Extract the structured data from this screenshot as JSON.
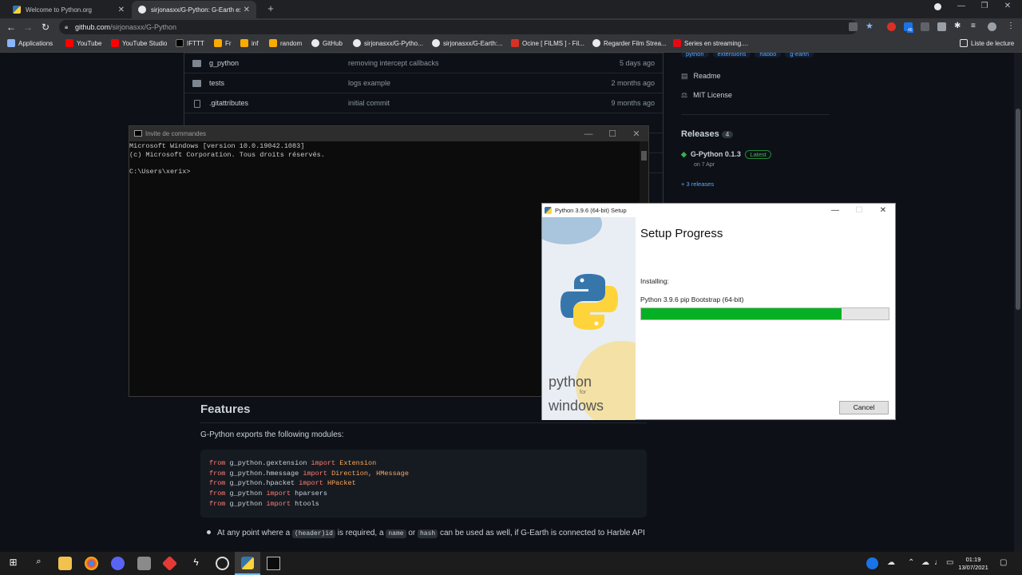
{
  "browser": {
    "tabs": [
      {
        "title": "Welcome to Python.org",
        "active": false
      },
      {
        "title": "sirjonasxx/G-Python: G-Earth ext",
        "active": true
      }
    ],
    "url_host": "github.com",
    "url_path": "/sirjonasxx/G-Python",
    "bookmarks": [
      "Applications",
      "YouTube",
      "YouTube Studio",
      "IFTTT",
      "Fr",
      "inf",
      "random",
      "GitHub",
      "sirjonasxx/G-Pytho...",
      "sirjonasxx/G-Earth:...",
      "Ocine [ FILMS ] - Fil...",
      "Regarder Film Strea...",
      "Series en streaming...."
    ],
    "reading_list": "Liste de lecture",
    "ext_badge": "45"
  },
  "repo": {
    "files": [
      {
        "name": "g_python",
        "message": "removing intercept callbacks",
        "age": "5 days ago",
        "type": "folder"
      },
      {
        "name": "tests",
        "message": "logs example",
        "age": "2 months ago",
        "type": "folder"
      },
      {
        "name": ".gitattributes",
        "message": "initial commit",
        "age": "9 months ago",
        "type": "file"
      }
    ],
    "topics": [
      "python",
      "extensions",
      "habbo",
      "g-earth"
    ],
    "readme": "Readme",
    "license": "MIT License",
    "releases_label": "Releases",
    "releases_count": "4",
    "release_name": "G-Python 0.1.3",
    "release_badge": "Latest",
    "release_date": "on 7 Apr",
    "more_releases": "+ 3 releases",
    "features_heading": "Features",
    "features_intro": "G-Python exports the following modules:",
    "code_lines": [
      {
        "mod": "g_python.gextension",
        "names": "Extension"
      },
      {
        "mod": "g_python.hmessage",
        "names": "Direction, HMessage"
      },
      {
        "mod": "g_python.hpacket",
        "names": "HPacket"
      },
      {
        "mod": "g_python",
        "names": "hparsers"
      },
      {
        "mod": "g_python",
        "names": "htools"
      }
    ],
    "bullet_parts": [
      "At any point where a ",
      "(header)id",
      " is required, a ",
      "name",
      " or ",
      "hash",
      " can be used as well, if G-Earth is connected to Harble API"
    ]
  },
  "cmd": {
    "title": "Invite de commandes",
    "lines": [
      "Microsoft Windows [version 10.0.19042.1083]",
      "(c) Microsoft Corporation. Tous droits réservés.",
      "",
      "C:\\Users\\xerix>"
    ]
  },
  "setup": {
    "title": "Python 3.9.6 (64-bit) Setup",
    "heading": "Setup Progress",
    "installing_label": "Installing:",
    "current_item": "Python 3.9.6 pip Bootstrap (64-bit)",
    "progress": 0.81,
    "cancel_label": "Cancel",
    "banner_line1": "python",
    "banner_line2": "for",
    "banner_line3": "windows"
  },
  "taskbar": {
    "time": "01:19",
    "date": "13/07/2021"
  },
  "colors": {
    "github_bg": "#0d1117",
    "progress_green": "#06b025",
    "python_blue": "#3776ab",
    "python_yellow": "#ffd43b"
  }
}
